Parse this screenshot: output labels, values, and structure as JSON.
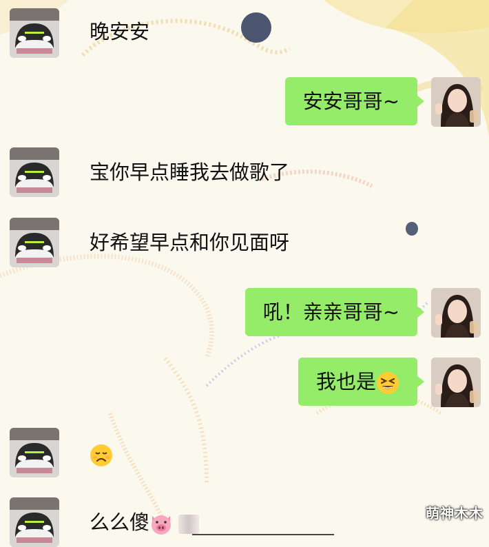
{
  "messages": [
    {
      "side": "left",
      "kind": "text",
      "text": "晚安安"
    },
    {
      "side": "right",
      "kind": "bubble",
      "text": "安安哥哥~"
    },
    {
      "side": "left",
      "kind": "text",
      "text": "宝你早点睡我去做歌了"
    },
    {
      "side": "left",
      "kind": "text",
      "text": "好希望早点和你见面呀"
    },
    {
      "side": "right",
      "kind": "bubble",
      "text": "吼！亲亲哥哥~"
    },
    {
      "side": "right",
      "kind": "bubble",
      "text": "我也是",
      "emoji": "grinning-squint-face-emoji"
    },
    {
      "side": "left",
      "kind": "emoji",
      "emoji": "frowning-face-emoji"
    },
    {
      "side": "left",
      "kind": "text",
      "text": "么么傻",
      "emoji": "pig-face-emoji",
      "redacted": true
    }
  ],
  "watermark": "萌神木木",
  "colors": {
    "bubble_green": "#95ec69",
    "text": "#111111",
    "background": "#fbf8ee"
  }
}
